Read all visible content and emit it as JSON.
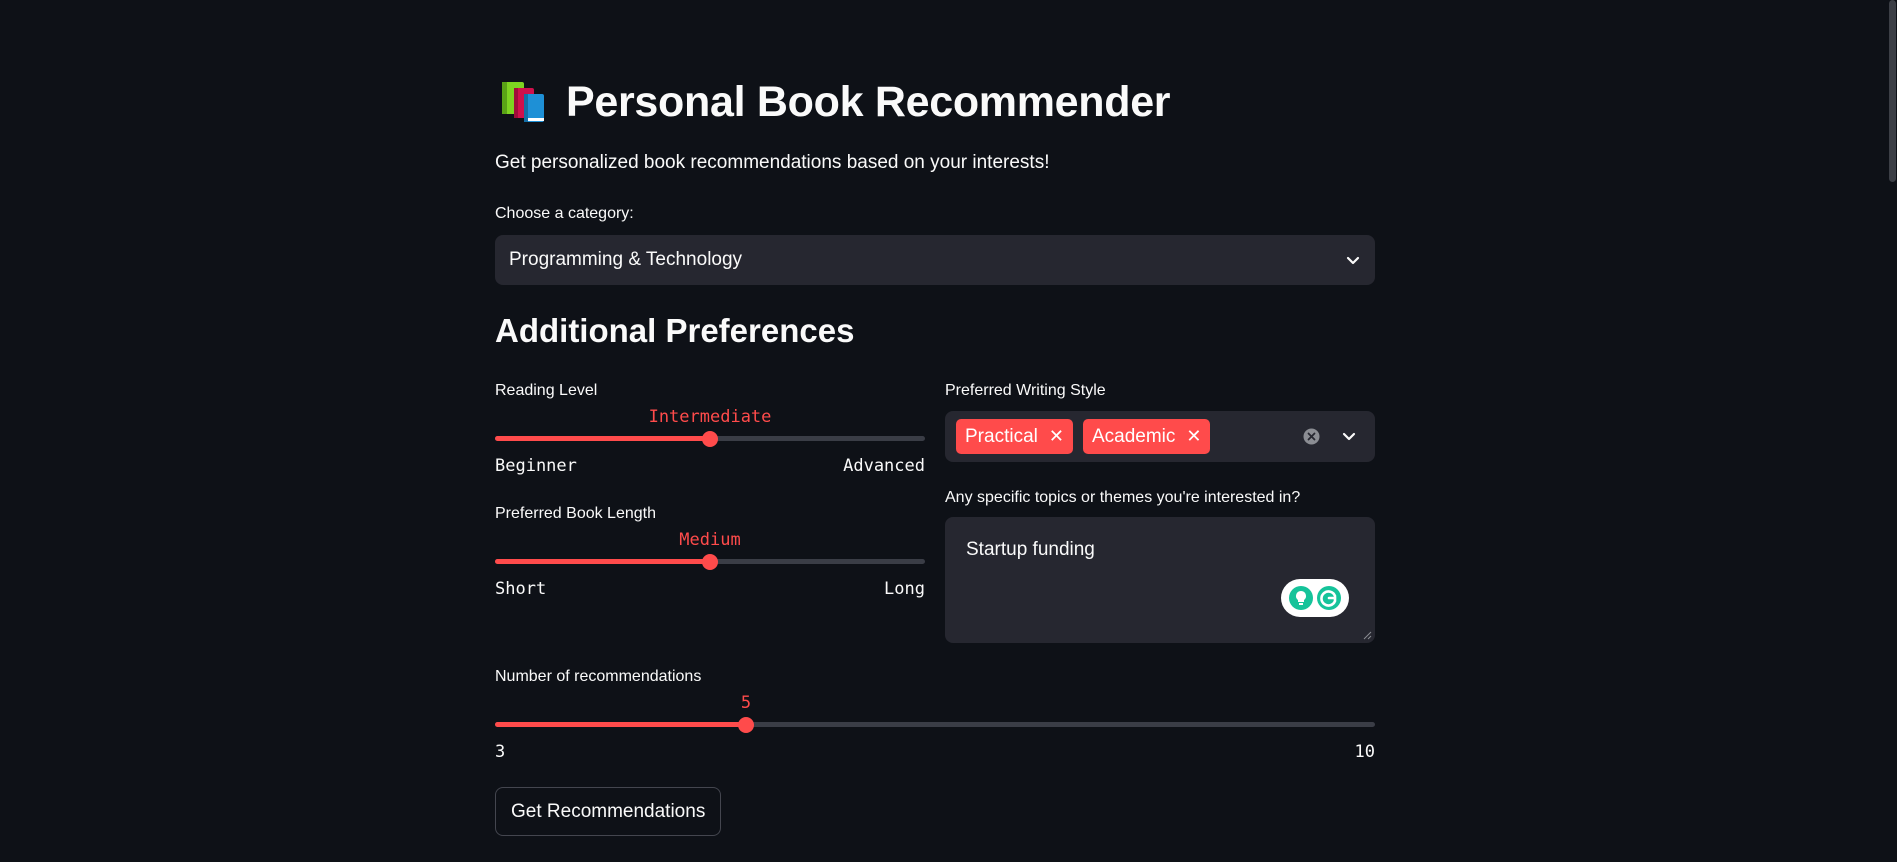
{
  "header": {
    "title": "Personal Book Recommender",
    "icon": "books-icon",
    "subtitle": "Get personalized book recommendations based on your interests!"
  },
  "category": {
    "label": "Choose a category:",
    "selected": "Programming & Technology"
  },
  "preferences": {
    "heading": "Additional Preferences",
    "reading_level": {
      "label": "Reading Level",
      "value": "Intermediate",
      "min_label": "Beginner",
      "max_label": "Advanced",
      "fraction": 0.5
    },
    "book_length": {
      "label": "Preferred Book Length",
      "value": "Medium",
      "min_label": "Short",
      "max_label": "Long",
      "fraction": 0.5
    },
    "writing_style": {
      "label": "Preferred Writing Style",
      "chips": [
        "Practical",
        "Academic"
      ]
    },
    "topics": {
      "label": "Any specific topics or themes you're interested in?",
      "value": "Startup funding"
    }
  },
  "recommendations": {
    "label": "Number of recommendations",
    "value": "5",
    "min_label": "3",
    "max_label": "10",
    "min": 3,
    "max": 10,
    "current": 5
  },
  "actions": {
    "submit_label": "Get Recommendations"
  },
  "colors": {
    "background": "#0e1117",
    "accent": "#ff4b4b",
    "input_bg": "#262730"
  }
}
